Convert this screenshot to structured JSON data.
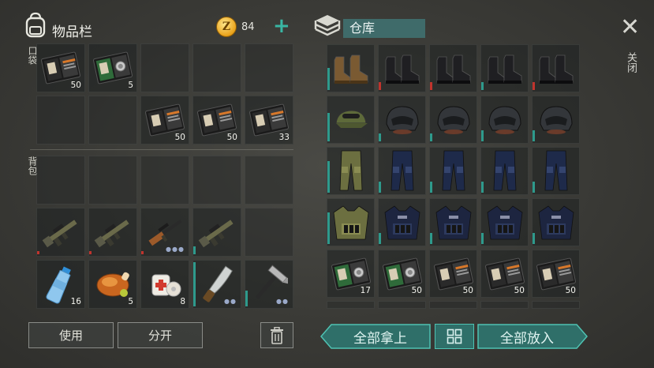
{
  "inventory": {
    "title": "物品栏",
    "coin_symbol": "Z",
    "coins": "84",
    "add_symbol": "+",
    "pocket_label": "口袋",
    "backpack_label": "背包",
    "pocket_slots": [
      {
        "item": "记事本",
        "count": "50"
      },
      {
        "item": "徽章记事本",
        "count": "5"
      },
      {
        "item": "",
        "count": ""
      },
      {
        "item": "",
        "count": ""
      },
      {
        "item": "",
        "count": ""
      },
      {
        "item": "",
        "count": ""
      },
      {
        "item": "",
        "count": ""
      },
      {
        "item": "记事本",
        "count": "50"
      },
      {
        "item": "记事本",
        "count": "50"
      },
      {
        "item": "记事本",
        "count": "33"
      }
    ],
    "backpack_slots": [
      {
        "item": "",
        "count": ""
      },
      {
        "item": "",
        "count": ""
      },
      {
        "item": "",
        "count": ""
      },
      {
        "item": "",
        "count": ""
      },
      {
        "item": "",
        "count": ""
      },
      {
        "item": "榴弹步枪",
        "count": ""
      },
      {
        "item": "榴弹步枪",
        "count": ""
      },
      {
        "item": "狙击步枪",
        "count": ""
      },
      {
        "item": "榴弹步枪",
        "count": ""
      },
      {
        "item": "",
        "count": ""
      },
      {
        "item": "水瓶",
        "count": "16"
      },
      {
        "item": "烤鸡",
        "count": "5"
      },
      {
        "item": "绷带",
        "count": "8"
      },
      {
        "item": "砍刀",
        "count": ""
      },
      {
        "item": "锤子",
        "count": ""
      }
    ],
    "use_button": "使用",
    "split_button": "分开"
  },
  "warehouse": {
    "title": "仓库",
    "close_label": "关闭",
    "close_symbol": "✕",
    "rows": [
      [
        {
          "item": "棕色靴子",
          "count": ""
        },
        {
          "item": "战术靴",
          "count": ""
        },
        {
          "item": "战术靴",
          "count": ""
        },
        {
          "item": "战术靴",
          "count": ""
        },
        {
          "item": "战术靴",
          "count": ""
        }
      ],
      [
        {
          "item": "迷彩帽",
          "count": ""
        },
        {
          "item": "防暴头盔",
          "count": ""
        },
        {
          "item": "防暴头盔",
          "count": ""
        },
        {
          "item": "防暴头盔",
          "count": ""
        },
        {
          "item": "防暴头盔",
          "count": ""
        }
      ],
      [
        {
          "item": "迷彩裤",
          "count": ""
        },
        {
          "item": "警用裤",
          "count": ""
        },
        {
          "item": "警用裤",
          "count": ""
        },
        {
          "item": "警用裤",
          "count": ""
        },
        {
          "item": "警用裤",
          "count": ""
        }
      ],
      [
        {
          "item": "迷彩背心",
          "count": ""
        },
        {
          "item": "防暴背心",
          "count": ""
        },
        {
          "item": "防暴背心",
          "count": ""
        },
        {
          "item": "防暴背心",
          "count": ""
        },
        {
          "item": "防暴背心",
          "count": ""
        }
      ],
      [
        {
          "item": "徽章记事本",
          "count": "17"
        },
        {
          "item": "徽章记事本",
          "count": "50"
        },
        {
          "item": "记事本",
          "count": "50"
        },
        {
          "item": "记事本",
          "count": "50"
        },
        {
          "item": "记事本",
          "count": "50"
        }
      ]
    ],
    "take_all_button": "全部拿上",
    "put_all_button": "全部放入"
  },
  "colors": {
    "teal": "#3aa494",
    "teal_dark": "#2d6f69",
    "durability_red": "#c0342d",
    "durability_teal": "#2e9a8c"
  }
}
